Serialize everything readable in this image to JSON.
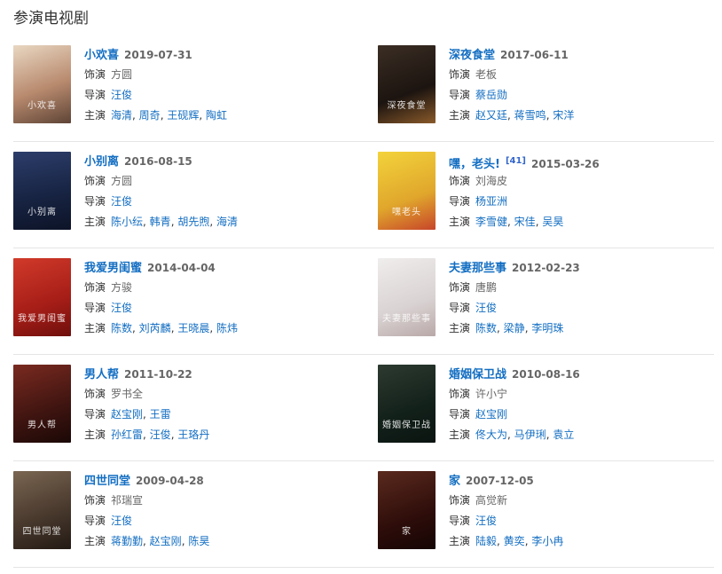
{
  "section_title": "参演电视剧",
  "labels": {
    "role": "饰演",
    "director": "导演",
    "cast": "主演"
  },
  "colors": {
    "link": "#136ec2",
    "divider": "#e5e5e5"
  },
  "rows": [
    [
      {
        "name": "小欢喜",
        "date": "2019-07-31",
        "ref": "",
        "role": "方圆",
        "directors": [
          "汪俊"
        ],
        "cast": [
          "海清",
          "周奇",
          "王砚辉",
          "陶虹"
        ],
        "poster_text": "小欢喜",
        "poster_bg": "#c9a890"
      },
      {
        "name": "深夜食堂",
        "date": "2017-06-11",
        "ref": "",
        "role": "老板",
        "directors": [
          "蔡岳勋"
        ],
        "cast": [
          "赵又廷",
          "蒋雪鸣",
          "宋洋"
        ],
        "poster_text": "深夜食堂",
        "poster_bg": "#2b2119"
      }
    ],
    [
      {
        "name": "小别离",
        "date": "2016-08-15",
        "ref": "",
        "role": "方圆",
        "directors": [
          "汪俊"
        ],
        "cast": [
          "陈小纭",
          "韩青",
          "胡先煦",
          "海清"
        ],
        "poster_text": "小别离",
        "poster_bg": "#1d2a4a"
      },
      {
        "name": "嘿，老头!",
        "date": "2015-03-26",
        "ref": "[41]",
        "role": "刘海皮",
        "directors": [
          "杨亚洲"
        ],
        "cast": [
          "李雪健",
          "宋佳",
          "吴昊"
        ],
        "poster_text": "嘿老头",
        "poster_bg": "#e8c93a"
      }
    ],
    [
      {
        "name": "我爱男闺蜜",
        "date": "2014-04-04",
        "ref": "",
        "role": "方骏",
        "directors": [
          "汪俊"
        ],
        "cast": [
          "陈数",
          "刘芮麟",
          "王晓晨",
          "陈炜"
        ],
        "poster_text": "我爱男闺蜜",
        "poster_bg": "#b8221c"
      },
      {
        "name": "夫妻那些事",
        "date": "2012-02-23",
        "ref": "",
        "role": "唐鹏",
        "directors": [
          "汪俊"
        ],
        "cast": [
          "陈数",
          "梁静",
          "李明珠"
        ],
        "poster_text": "夫妻那些事",
        "poster_bg": "#e3dede"
      }
    ],
    [
      {
        "name": "男人帮",
        "date": "2011-10-22",
        "ref": "",
        "role": "罗书全",
        "directors": [
          "赵宝刚",
          "王雷"
        ],
        "cast": [
          "孙红雷",
          "汪俊",
          "王珞丹"
        ],
        "poster_text": "男人帮",
        "poster_bg": "#5a1f1a"
      },
      {
        "name": "婚姻保卫战",
        "date": "2010-08-16",
        "ref": "",
        "role": "许小宁",
        "directors": [
          "赵宝刚"
        ],
        "cast": [
          "佟大为",
          "马伊琍",
          "袁立"
        ],
        "poster_text": "婚姻保卫战",
        "poster_bg": "#1e2a22"
      }
    ],
    [
      {
        "name": "四世同堂",
        "date": "2009-04-28",
        "ref": "",
        "role": "祁瑞宣",
        "directors": [
          "汪俊"
        ],
        "cast": [
          "蒋勤勤",
          "赵宝刚",
          "陈昊"
        ],
        "poster_text": "四世同堂",
        "poster_bg": "#4a3a2e"
      },
      {
        "name": "家",
        "date": "2007-12-05",
        "ref": "",
        "role": "高觉新",
        "directors": [
          "汪俊"
        ],
        "cast": [
          "陆毅",
          "黄奕",
          "李小冉"
        ],
        "poster_text": "家",
        "poster_bg": "#3a1612"
      }
    ]
  ]
}
